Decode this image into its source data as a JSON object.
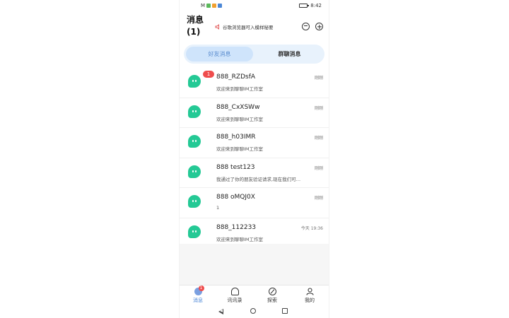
{
  "status_bar": {
    "carrier": "M",
    "time": "8:42"
  },
  "header": {
    "title": "消息",
    "count": "(1)",
    "notice": "谷歌浏览器可入模样秘要"
  },
  "tabs": [
    {
      "label": "好友消息",
      "active": true
    },
    {
      "label": "群聊消息",
      "active": false
    }
  ],
  "conversations": [
    {
      "name": "888_RZDsfA",
      "message": "欢迎来到聊聊IM工作室",
      "time": "刚刚",
      "unread": "1"
    },
    {
      "name": "888_CxXSWw",
      "message": "欢迎来到聊聊IM工作室",
      "time": "刚刚",
      "unread": ""
    },
    {
      "name": "888_h03IMR",
      "message": "欢迎来到聊聊IM工作室",
      "time": "刚刚",
      "unread": ""
    },
    {
      "name": "888 test123",
      "message": "我通过了你的朋友验证请求,现在我们可以...",
      "time": "刚刚",
      "unread": ""
    },
    {
      "name": "888 oMQJ0X",
      "message": "1",
      "time": "刚刚",
      "unread": ""
    },
    {
      "name": "888_112233",
      "message": "欢迎来到聊聊IM工作室",
      "time": "今天 19:36",
      "unread": ""
    }
  ],
  "bottom_nav": [
    {
      "label": "消息",
      "icon": "chat-icon",
      "active": true,
      "badge": "1"
    },
    {
      "label": "讯讯录",
      "icon": "contacts-icon",
      "active": false
    },
    {
      "label": "探索",
      "icon": "compass-icon",
      "active": false
    },
    {
      "label": "我的",
      "icon": "person-icon",
      "active": false
    }
  ],
  "colors": {
    "accent": "#4a86d6",
    "avatar": "#24c995",
    "badge": "#ef4d4d",
    "tab_bg": "#e8f2fc"
  }
}
